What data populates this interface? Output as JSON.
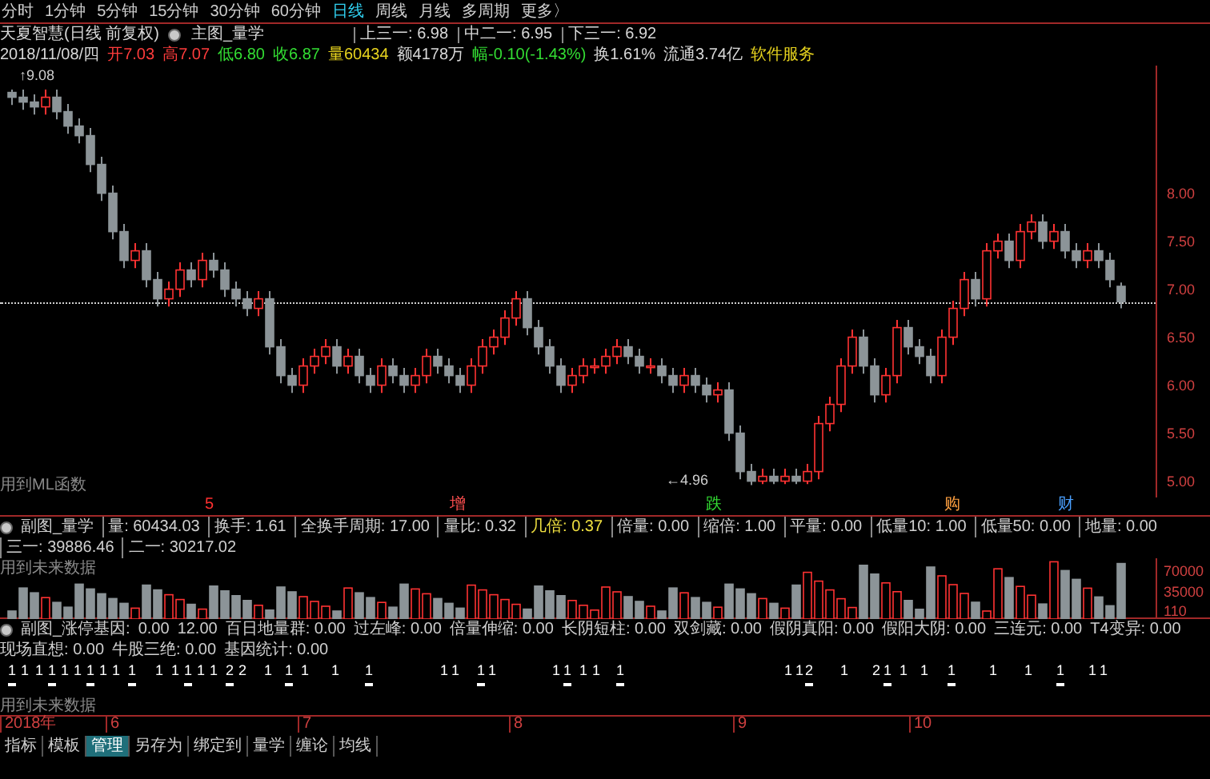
{
  "period_tabs": [
    {
      "label": "分时",
      "selected": false
    },
    {
      "label": "1分钟",
      "selected": false
    },
    {
      "label": "5分钟",
      "selected": false
    },
    {
      "label": "15分钟",
      "selected": false
    },
    {
      "label": "30分钟",
      "selected": false
    },
    {
      "label": "60分钟",
      "selected": false
    },
    {
      "label": "日线",
      "selected": true
    },
    {
      "label": "周线",
      "selected": false
    },
    {
      "label": "月线",
      "selected": false
    },
    {
      "label": "多周期",
      "selected": false
    },
    {
      "label": "更多〉",
      "selected": false
    }
  ],
  "main_header": {
    "stock": "天夏智慧(日线 前复权)",
    "indicator": "主图_量学",
    "lines": [
      {
        "label": "上三一:",
        "value": "6.98"
      },
      {
        "label": "中二一:",
        "value": "6.95"
      },
      {
        "label": "下三一:",
        "value": "6.92"
      }
    ]
  },
  "quote": {
    "date": "2018/11/08/四",
    "items": [
      {
        "label": "开",
        "value": "7.03",
        "color": "#ff3c3c"
      },
      {
        "label": "高",
        "value": "7.07",
        "color": "#ff3c3c"
      },
      {
        "label": "低",
        "value": "6.80",
        "color": "#33dd33"
      },
      {
        "label": "收",
        "value": "6.87",
        "color": "#33dd33"
      },
      {
        "label": "量",
        "value": "60434",
        "color": "#e6d21e"
      },
      {
        "label": "额",
        "value": "4178万",
        "color": "#d8d8d8"
      },
      {
        "label": "幅",
        "value": "-0.10(-1.43%)",
        "color": "#33dd33"
      },
      {
        "label": "换",
        "value": "1.61%",
        "color": "#d8d8d8"
      },
      {
        "label": "流通",
        "value": "3.74亿",
        "color": "#d8d8d8"
      }
    ],
    "sector": "软件服务"
  },
  "main_chart": {
    "high_label": "↑9.08",
    "low_label": "←4.96",
    "formula_note": "用到ML函数",
    "chart_data": {
      "type": "candlestick",
      "ylim": [
        4.83,
        9.33
      ],
      "yticks": [
        {
          "value": 8,
          "label": "8.00"
        },
        {
          "value": 7.5,
          "label": "7.50"
        },
        {
          "value": 7,
          "label": "7.00"
        },
        {
          "value": 6.5,
          "label": "6.50"
        },
        {
          "value": 6,
          "label": "6.00"
        },
        {
          "value": 5.5,
          "label": "5.50"
        },
        {
          "value": 5,
          "label": "5.00"
        }
      ],
      "ohlc": [
        [
          9.05,
          9.08,
          8.92,
          9.0
        ],
        [
          9.0,
          9.08,
          8.87,
          8.95
        ],
        [
          8.95,
          9.03,
          8.82,
          8.9
        ],
        [
          8.9,
          9.08,
          8.82,
          9.0
        ],
        [
          9.0,
          9.08,
          8.77,
          8.85
        ],
        [
          8.85,
          8.93,
          8.62,
          8.7
        ],
        [
          8.7,
          8.78,
          8.52,
          8.6
        ],
        [
          8.6,
          8.68,
          8.22,
          8.3
        ],
        [
          8.3,
          8.38,
          7.92,
          8.0
        ],
        [
          8.0,
          8.08,
          7.52,
          7.6
        ],
        [
          7.6,
          7.68,
          7.22,
          7.3
        ],
        [
          7.3,
          7.48,
          7.22,
          7.4
        ],
        [
          7.4,
          7.48,
          7.02,
          7.1
        ],
        [
          7.1,
          7.18,
          6.82,
          6.9
        ],
        [
          6.9,
          7.08,
          6.82,
          7.0
        ],
        [
          7.0,
          7.28,
          6.92,
          7.2
        ],
        [
          7.2,
          7.28,
          7.02,
          7.1
        ],
        [
          7.1,
          7.38,
          7.02,
          7.3
        ],
        [
          7.3,
          7.38,
          7.12,
          7.2
        ],
        [
          7.2,
          7.28,
          6.92,
          7.0
        ],
        [
          7.0,
          7.08,
          6.82,
          6.9
        ],
        [
          6.9,
          6.98,
          6.72,
          6.8
        ],
        [
          6.8,
          6.98,
          6.72,
          6.9
        ],
        [
          6.9,
          6.98,
          6.32,
          6.4
        ],
        [
          6.4,
          6.48,
          6.02,
          6.1
        ],
        [
          6.1,
          6.18,
          5.92,
          6.0
        ],
        [
          6.0,
          6.28,
          5.92,
          6.2
        ],
        [
          6.2,
          6.38,
          6.12,
          6.3
        ],
        [
          6.3,
          6.48,
          6.22,
          6.4
        ],
        [
          6.4,
          6.48,
          6.12,
          6.2
        ],
        [
          6.2,
          6.38,
          6.12,
          6.3
        ],
        [
          6.3,
          6.38,
          6.02,
          6.1
        ],
        [
          6.1,
          6.18,
          5.92,
          6.0
        ],
        [
          6.0,
          6.28,
          5.92,
          6.2
        ],
        [
          6.2,
          6.28,
          6.02,
          6.1
        ],
        [
          6.1,
          6.18,
          5.92,
          6.0
        ],
        [
          6.0,
          6.18,
          5.92,
          6.1
        ],
        [
          6.1,
          6.38,
          6.02,
          6.3
        ],
        [
          6.3,
          6.38,
          6.12,
          6.2
        ],
        [
          6.2,
          6.28,
          6.02,
          6.1
        ],
        [
          6.1,
          6.18,
          5.92,
          6.0
        ],
        [
          6.0,
          6.28,
          5.92,
          6.2
        ],
        [
          6.2,
          6.48,
          6.12,
          6.4
        ],
        [
          6.4,
          6.58,
          6.32,
          6.5
        ],
        [
          6.5,
          6.78,
          6.42,
          6.7
        ],
        [
          6.7,
          6.98,
          6.62,
          6.9
        ],
        [
          6.9,
          6.98,
          6.52,
          6.6
        ],
        [
          6.6,
          6.68,
          6.32,
          6.4
        ],
        [
          6.4,
          6.48,
          6.12,
          6.2
        ],
        [
          6.2,
          6.28,
          5.92,
          6.0
        ],
        [
          6.0,
          6.18,
          5.92,
          6.1
        ],
        [
          6.1,
          6.28,
          6.02,
          6.2
        ],
        [
          6.2,
          6.28,
          6.12,
          6.2
        ],
        [
          6.2,
          6.38,
          6.12,
          6.3
        ],
        [
          6.3,
          6.48,
          6.22,
          6.4
        ],
        [
          6.4,
          6.48,
          6.22,
          6.3
        ],
        [
          6.3,
          6.38,
          6.12,
          6.2
        ],
        [
          6.2,
          6.28,
          6.12,
          6.2
        ],
        [
          6.2,
          6.28,
          6.02,
          6.1
        ],
        [
          6.1,
          6.18,
          5.92,
          6.0
        ],
        [
          6.0,
          6.18,
          5.92,
          6.1
        ],
        [
          6.1,
          6.18,
          5.92,
          6.0
        ],
        [
          6.0,
          6.08,
          5.82,
          5.9
        ],
        [
          5.9,
          6.03,
          5.82,
          5.95
        ],
        [
          5.95,
          6.03,
          5.42,
          5.5
        ],
        [
          5.5,
          5.58,
          5.02,
          5.1
        ],
        [
          5.1,
          5.18,
          4.96,
          5.0
        ],
        [
          5.0,
          5.13,
          4.97,
          5.05
        ],
        [
          5.05,
          5.13,
          4.97,
          5.0
        ],
        [
          5.0,
          5.13,
          4.97,
          5.05
        ],
        [
          5.05,
          5.13,
          4.97,
          5.0
        ],
        [
          5.0,
          5.18,
          4.97,
          5.1
        ],
        [
          5.1,
          5.68,
          5.02,
          5.6
        ],
        [
          5.6,
          5.88,
          5.52,
          5.8
        ],
        [
          5.8,
          6.28,
          5.72,
          6.2
        ],
        [
          6.2,
          6.58,
          6.12,
          6.5
        ],
        [
          6.5,
          6.58,
          6.12,
          6.2
        ],
        [
          6.2,
          6.28,
          5.82,
          5.9
        ],
        [
          5.9,
          6.18,
          5.82,
          6.1
        ],
        [
          6.1,
          6.68,
          6.02,
          6.6
        ],
        [
          6.6,
          6.68,
          6.32,
          6.4
        ],
        [
          6.4,
          6.48,
          6.22,
          6.3
        ],
        [
          6.3,
          6.38,
          6.02,
          6.1
        ],
        [
          6.1,
          6.58,
          6.02,
          6.5
        ],
        [
          6.5,
          6.88,
          6.42,
          6.8
        ],
        [
          6.8,
          7.18,
          6.72,
          7.1
        ],
        [
          7.1,
          7.18,
          6.82,
          6.9
        ],
        [
          6.9,
          7.48,
          6.82,
          7.4
        ],
        [
          7.4,
          7.58,
          7.32,
          7.5
        ],
        [
          7.5,
          7.58,
          7.22,
          7.3
        ],
        [
          7.3,
          7.68,
          7.22,
          7.6
        ],
        [
          7.6,
          7.78,
          7.52,
          7.7
        ],
        [
          7.7,
          7.78,
          7.42,
          7.5
        ],
        [
          7.5,
          7.68,
          7.42,
          7.6
        ],
        [
          7.6,
          7.68,
          7.32,
          7.4
        ],
        [
          7.4,
          7.48,
          7.22,
          7.3
        ],
        [
          7.3,
          7.48,
          7.22,
          7.4
        ],
        [
          7.4,
          7.48,
          7.22,
          7.3
        ],
        [
          7.3,
          7.38,
          7.02,
          7.1
        ],
        [
          7.03,
          7.07,
          6.8,
          6.87
        ]
      ]
    }
  },
  "event_markers": [
    {
      "label": "5",
      "color": "#ff3030"
    },
    {
      "label": "增",
      "color": "#ff5050"
    },
    {
      "label": "跌",
      "color": "#33dd33"
    },
    {
      "label": "购",
      "color": "#ffa040"
    },
    {
      "label": "财",
      "color": "#4aa0ff"
    }
  ],
  "volume_panel": {
    "indicator": "副图_量学",
    "items": [
      {
        "label": "量:",
        "value": "60434.03",
        "highlighted": false
      },
      {
        "label": "换手:",
        "value": "1.61",
        "highlighted": false
      },
      {
        "label": "全换手周期:",
        "value": "17.00",
        "highlighted": false
      },
      {
        "label": "量比:",
        "value": "0.32",
        "highlighted": false
      },
      {
        "label": "几倍:",
        "value": "0.37",
        "highlighted": true
      },
      {
        "label": "倍量:",
        "value": "0.00",
        "highlighted": false
      },
      {
        "label": "缩倍:",
        "value": "1.00",
        "highlighted": false
      },
      {
        "label": "平量:",
        "value": "0.00",
        "highlighted": false
      },
      {
        "label": "低量10:",
        "value": "1.00",
        "highlighted": false
      },
      {
        "label": "低量50:",
        "value": "0.00",
        "highlighted": false
      },
      {
        "label": "地量:",
        "value": "0.00",
        "highlighted": false
      },
      {
        "label": "三一:",
        "value": "39886.46",
        "highlighted": false
      },
      {
        "label": "二一:",
        "value": "30217.02",
        "highlighted": false
      }
    ],
    "note": "用到未来数据",
    "axis": [
      "70000",
      "35000",
      "110"
    ]
  },
  "gene_panel": {
    "indicator": "副图_涨停基因:",
    "values": [
      "0.00",
      "12.00"
    ],
    "items": [
      {
        "label": "百日地量群:",
        "value": "0.00"
      },
      {
        "label": "过左峰:",
        "value": "0.00"
      },
      {
        "label": "倍量伸缩:",
        "value": "0.00"
      },
      {
        "label": "长阴短柱:",
        "value": "0.00"
      },
      {
        "label": "双剑藏:",
        "value": "0.00"
      },
      {
        "label": "假阴真阳:",
        "value": "0.00"
      },
      {
        "label": "假阳大阴:",
        "value": "0.00"
      },
      {
        "label": "三连元:",
        "value": "0.00"
      },
      {
        "label": "T4变异:",
        "value": "0.00"
      },
      {
        "label": "现场直想:",
        "value": "0.00"
      },
      {
        "label": "牛股三绝:",
        "value": "0.00"
      },
      {
        "label": "基因统计:",
        "value": "0.00"
      }
    ],
    "signals": [
      "1",
      "1",
      "1",
      "1",
      "1",
      "1",
      "1",
      "1",
      "1",
      "1",
      "1",
      "1",
      "1",
      "1",
      "1",
      "2",
      "2",
      "1",
      "1",
      "1",
      "1",
      "1",
      "1",
      "1",
      "1",
      "1",
      "1",
      "1",
      "1",
      "1",
      "1",
      "1",
      "1",
      "2",
      "1",
      "2",
      "1",
      "1",
      "1",
      "1",
      "1",
      "1",
      "1",
      "1",
      "1"
    ],
    "note": "用到未来数据"
  },
  "date_axis": [
    "2018年",
    "6",
    "7",
    "8",
    "9",
    "10"
  ],
  "bottom_tabs": [
    {
      "label": "指标",
      "selected": false
    },
    {
      "label": "模板",
      "selected": false
    },
    {
      "label": "管理",
      "selected": true
    },
    {
      "label": "另存为",
      "selected": false
    },
    {
      "label": "绑定到",
      "selected": false
    },
    {
      "label": "量学",
      "selected": false
    },
    {
      "label": "缠论",
      "selected": false
    },
    {
      "label": "均线",
      "selected": false
    }
  ]
}
